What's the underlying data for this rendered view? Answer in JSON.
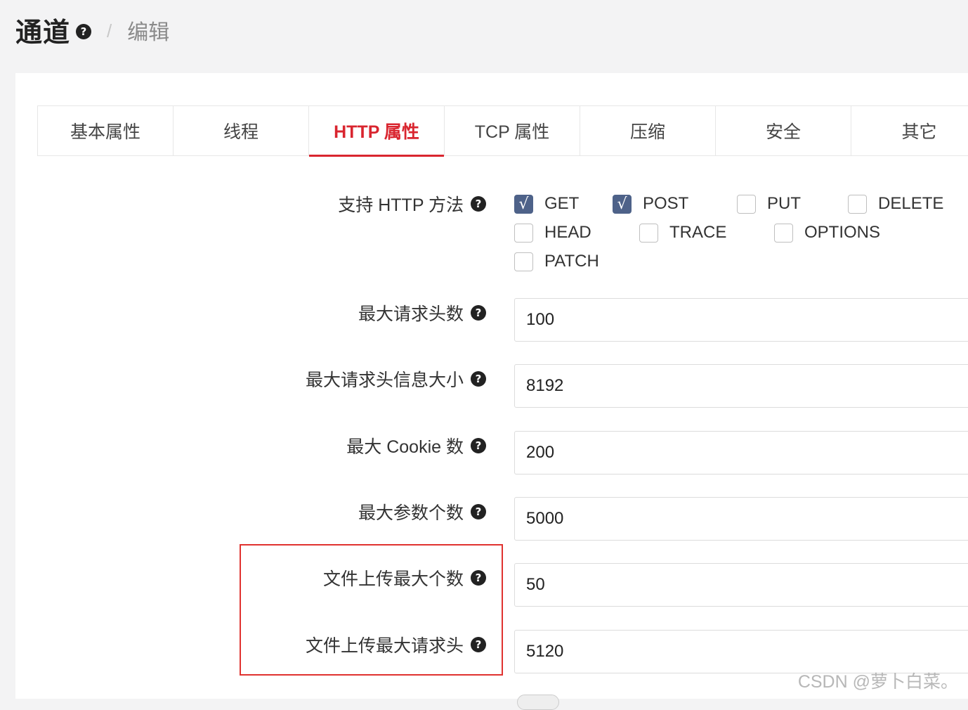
{
  "header": {
    "title": "通道",
    "breadcrumb_current": "编辑",
    "breadcrumb_separator": "/"
  },
  "tabs": [
    {
      "label": "基本属性",
      "active": false
    },
    {
      "label": "线程",
      "active": false
    },
    {
      "label": "HTTP 属性",
      "active": true
    },
    {
      "label": "TCP 属性",
      "active": false
    },
    {
      "label": "压缩",
      "active": false
    },
    {
      "label": "安全",
      "active": false
    },
    {
      "label": "其它",
      "active": false
    }
  ],
  "form": {
    "methods": {
      "label": "支持 HTTP 方法",
      "options": [
        {
          "label": "GET",
          "checked": true
        },
        {
          "label": "POST",
          "checked": true
        },
        {
          "label": "PUT",
          "checked": false
        },
        {
          "label": "DELETE",
          "checked": false
        },
        {
          "label": "HEAD",
          "checked": false
        },
        {
          "label": "TRACE",
          "checked": false
        },
        {
          "label": "OPTIONS",
          "checked": false
        },
        {
          "label": "PATCH",
          "checked": false
        }
      ]
    },
    "max_headers": {
      "label": "最大请求头数",
      "value": "100"
    },
    "max_header_size": {
      "label": "最大请求头信息大小",
      "value": "8192"
    },
    "max_cookies": {
      "label": "最大 Cookie 数",
      "value": "200"
    },
    "max_params": {
      "label": "最大参数个数",
      "value": "5000"
    },
    "max_upload_files": {
      "label": "文件上传最大个数",
      "value": "50"
    },
    "max_upload_header": {
      "label": "文件上传最大请求头",
      "value": "5120"
    }
  },
  "icons": {
    "help": "question-circle-icon",
    "check_mark": "√"
  },
  "colors": {
    "accent_red": "#d9252f",
    "checkbox_checked": "#4e6289",
    "highlight_border": "#e0322f"
  },
  "watermark": "CSDN @萝卜白菜。"
}
